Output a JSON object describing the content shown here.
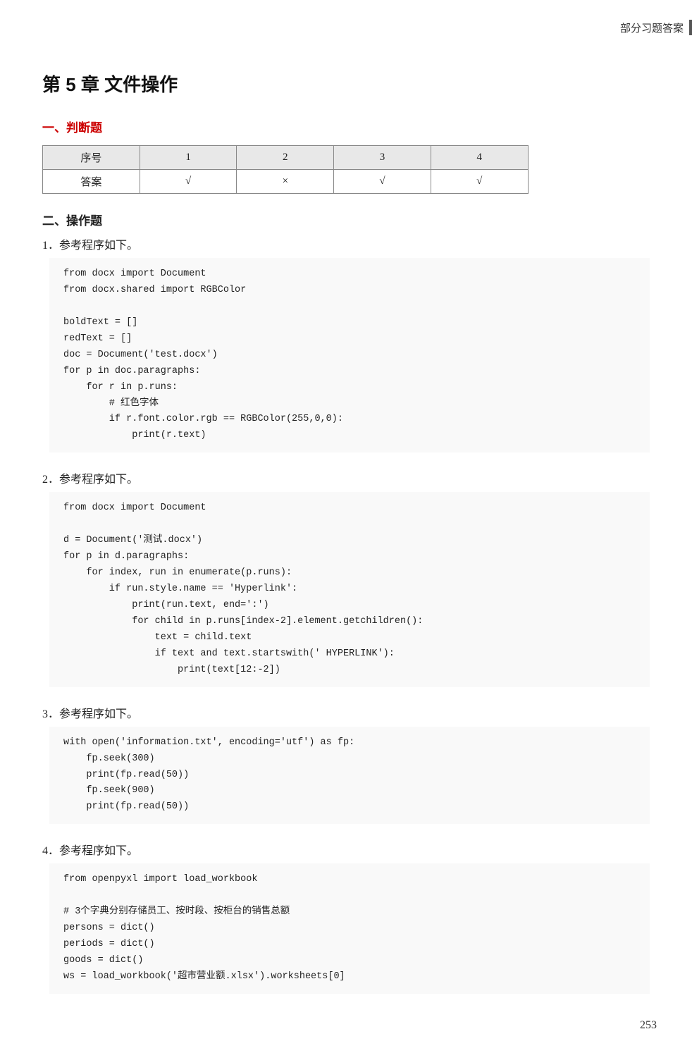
{
  "header": {
    "top_right_label": "部分习题答案"
  },
  "chapter": {
    "title": "第 5 章   文件操作"
  },
  "section1": {
    "heading": "一、判断题",
    "table": {
      "col_header": "序号",
      "row_header": "答案",
      "columns": [
        "1",
        "2",
        "3",
        "4"
      ],
      "answers": [
        "√",
        "×",
        "√",
        "√"
      ]
    }
  },
  "section2": {
    "heading": "二、操作题",
    "questions": [
      {
        "label": "1．参考程序如下。",
        "code": "from docx import Document\nfrom docx.shared import RGBColor\n\nboldText = []\nredText = []\ndoc = Document('test.docx')\nfor p in doc.paragraphs:\n    for r in p.runs:\n        # 红色字体\n        if r.font.color.rgb == RGBColor(255,0,0):\n            print(r.text)"
      },
      {
        "label": "2．参考程序如下。",
        "code": "from docx import Document\n\nd = Document('测试.docx')\nfor p in d.paragraphs:\n    for index, run in enumerate(p.runs):\n        if run.style.name == 'Hyperlink':\n            print(run.text, end=':')\n            for child in p.runs[index-2].element.getchildren():\n                text = child.text\n                if text and text.startswith(' HYPERLINK'):\n                    print(text[12:-2])"
      },
      {
        "label": "3．参考程序如下。",
        "code": "with open('information.txt', encoding='utf') as fp:\n    fp.seek(300)\n    print(fp.read(50))\n    fp.seek(900)\n    print(fp.read(50))"
      },
      {
        "label": "4．参考程序如下。",
        "code": "from openpyxl import load_workbook\n\n# 3个字典分别存储员工、按时段、按柜台的销售总额\npersons = dict()\nperiods = dict()\ngoods = dict()\nws = load_workbook('超市营业额.xlsx').worksheets[0]"
      }
    ]
  },
  "page_number": "253"
}
